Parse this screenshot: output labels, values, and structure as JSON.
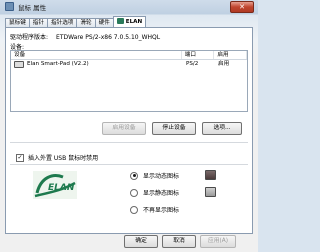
{
  "window": {
    "title": "鼠标 属性",
    "close_label": "✕"
  },
  "tabs": [
    {
      "label": "鼠标键"
    },
    {
      "label": "指针"
    },
    {
      "label": "指针选项"
    },
    {
      "label": "滑轮"
    },
    {
      "label": "硬件"
    },
    {
      "label": "ELAN",
      "active": true
    }
  ],
  "driver": {
    "label": "驱动程序版本:",
    "value": "ETDWare PS/2-x86 7.0.5.10_WHQL"
  },
  "devices": {
    "label": "设备:",
    "columns": [
      "设备",
      "端口",
      "启用"
    ],
    "rows": [
      {
        "name": "Elan Smart-Pad  (V2.2)",
        "port": "PS/2",
        "enabled": "启用"
      }
    ]
  },
  "buttons": {
    "enable": "启用设备",
    "disable": "停止设备",
    "options": "选项..."
  },
  "usb_disable": {
    "label": "插入外置 USB 鼠标时禁用",
    "checked": true
  },
  "logo": {
    "text": "ELAN"
  },
  "tray_icon": {
    "options": [
      {
        "label": "显示动态图标",
        "selected": true
      },
      {
        "label": "显示静态图标",
        "selected": false
      },
      {
        "label": "不再显示图标",
        "selected": false
      }
    ]
  },
  "dialog_buttons": {
    "ok": "确定",
    "cancel": "取消",
    "apply": "应用(A)"
  },
  "colors": {
    "logo_green": "#1e7a4e",
    "title_bar": "#bfd0e2"
  }
}
